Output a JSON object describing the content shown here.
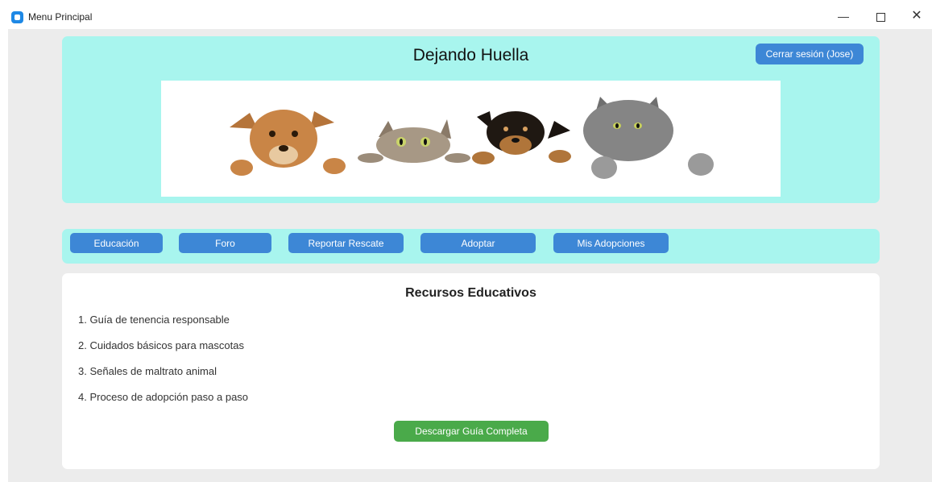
{
  "window": {
    "title": "Menu Principal",
    "icon": "app-icon",
    "controls": {
      "minimize": "—",
      "close": "✕"
    }
  },
  "header": {
    "app_title": "Dejando Huella",
    "logout_label": "Cerrar sesión (Jose)",
    "banner_image": "dogs-and-cats-peeking-banner"
  },
  "nav": {
    "items": [
      {
        "label": "Educación"
      },
      {
        "label": "Foro"
      },
      {
        "label": "Reportar Rescate"
      },
      {
        "label": "Adoptar"
      },
      {
        "label": "Mis Adopciones"
      }
    ]
  },
  "content": {
    "title": "Recursos Educativos",
    "resources": [
      "1. Guía de tenencia responsable",
      "2. Cuidados básicos para mascotas",
      "3. Señales de maltrato animal",
      "4. Proceso de adopción paso a paso"
    ],
    "download_label": "Descargar Guía Completa"
  },
  "colors": {
    "panel_bg": "#a8f5ee",
    "button_blue": "#3d87d6",
    "button_green": "#4aaa4a",
    "window_bg": "#ececec"
  }
}
